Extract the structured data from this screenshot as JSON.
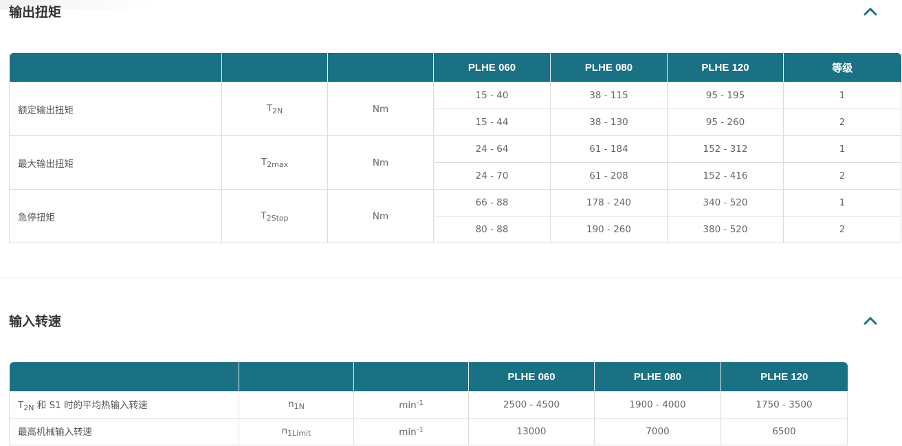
{
  "torque": {
    "title": "输出扭矩",
    "headers": [
      "",
      "",
      "",
      "PLHE 060",
      "PLHE 080",
      "PLHE 120",
      "等级"
    ],
    "groups": [
      {
        "label": "额定输出扭矩",
        "symbol_base": "T",
        "symbol_sub": "2N",
        "unit": "Nm",
        "rows": [
          [
            "15 - 40",
            "38 - 115",
            "95 - 195",
            "1"
          ],
          [
            "15 - 44",
            "38 - 130",
            "95 - 260",
            "2"
          ]
        ]
      },
      {
        "label": "最大输出扭矩",
        "symbol_base": "T",
        "symbol_sub": "2max",
        "unit": "Nm",
        "rows": [
          [
            "24 - 64",
            "61 - 184",
            "152 - 312",
            "1"
          ],
          [
            "24 - 70",
            "61 - 208",
            "152 - 416",
            "2"
          ]
        ]
      },
      {
        "label": "急停扭矩",
        "symbol_base": "T",
        "symbol_sub": "2Stop",
        "unit": "Nm",
        "rows": [
          [
            "66 - 88",
            "178 - 240",
            "340 - 520",
            "1"
          ],
          [
            "80 - 88",
            "190 - 260",
            "380 - 520",
            "2"
          ]
        ]
      }
    ]
  },
  "speed": {
    "title": "输入转速",
    "headers": [
      "",
      "",
      "",
      "PLHE 060",
      "PLHE 080",
      "PLHE 120"
    ],
    "rows": [
      {
        "label_prefix": "T",
        "label_sub": "2N",
        "label_rest": " 和 S1 时的平均热输入转速",
        "symbol_base": "n",
        "symbol_sub": "1N",
        "unit_base": "min",
        "unit_sup": "-1",
        "values": [
          "2500 - 4500",
          "1900 - 4000",
          "1750 - 3500"
        ]
      },
      {
        "label_prefix": "最高机械输入转速",
        "label_sub": "",
        "label_rest": "",
        "symbol_base": "n",
        "symbol_sub": "1Limit",
        "unit_base": "min",
        "unit_sup": "-1",
        "values": [
          "13000",
          "7000",
          "6500"
        ]
      }
    ]
  },
  "icons": {
    "collapse": "chevron-up-icon",
    "accent": "#1b7184"
  }
}
